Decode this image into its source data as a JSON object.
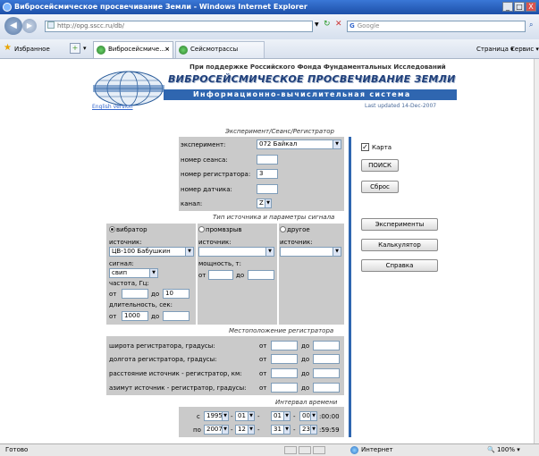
{
  "window": {
    "title": "Вибросейсмическое просвечивание Земли - Windows Internet Explorer",
    "min_label": "_",
    "max_label": "□",
    "close_label": "X"
  },
  "nav": {
    "address": "http://opg.sscc.ru/db/",
    "search_placeholder": "Google"
  },
  "tabs": {
    "favorites_label": "Избранное",
    "tab1": "Вибросейсмиче...",
    "tab2": "Сейсмотрассы",
    "page_menu": "Страница",
    "service_menu": "Сервис"
  },
  "header": {
    "support": "При поддержке Российского Фонда Фундаментальных Исследований",
    "title": "ВИБРОСЕЙСМИЧЕСКОЕ ПРОСВЕЧИВАНИЕ ЗЕМЛИ",
    "subtitle": "Информационно-вычислительная система",
    "english_link": "English version",
    "updated": "Last updated 14-Dec-2007"
  },
  "experiment": {
    "section_title": "Эксперимент/Сеанс/Регистратор",
    "experiment_label": "эксперимент:",
    "experiment_value": "072 Байкал",
    "session_label": "номер сеанса:",
    "session_value": "",
    "recorder_label": "номер регистратора:",
    "recorder_value": "3",
    "sensor_label": "номер датчика:",
    "sensor_value": "",
    "channel_label": "канал:",
    "channel_value": "Z"
  },
  "source": {
    "section_title": "Тип источника и параметры сигнала",
    "vibrator_label": "вибратор",
    "blast_label": "промвзрыв",
    "other_label": "другое",
    "source_label": "источник:",
    "vibrator_source_value": "ЦВ-100 Бабушкин",
    "blast_source_value": "",
    "other_source_value": "",
    "signal_label": "сигнал:",
    "signal_value": "свип",
    "power_label": "мощность, т:",
    "freq_label": "частота, Гц:",
    "from_label": "от",
    "to_label": "до",
    "freq_from": "",
    "freq_to": "10",
    "power_from": "",
    "power_to": "",
    "duration_label": "длительность, сек:",
    "duration_from": "1000",
    "duration_to": ""
  },
  "location": {
    "section_title": "Местоположение регистратора",
    "rows": [
      {
        "label": "широта регистратора, градусы:",
        "from_label": "от",
        "to_label": "до",
        "from": "",
        "to": ""
      },
      {
        "label": "долгота регистратора, градусы:",
        "from_label": "от",
        "to_label": "до",
        "from": "",
        "to": ""
      },
      {
        "label": "расстояние источник - регистратор, км:",
        "from_label": "от",
        "to_label": "до",
        "from": "",
        "to": ""
      },
      {
        "label": "азимут источник - регистратор, градусы:",
        "from_label": "от",
        "to_label": "до",
        "from": "",
        "to": ""
      }
    ]
  },
  "time": {
    "section_title": "Интервал времени",
    "from_label": "с",
    "to_label": "по",
    "from_year": "1995",
    "from_month": "01",
    "from_day": "01",
    "from_hour": "00",
    "from_rest": ":00:00",
    "to_year": "2007",
    "to_month": "12",
    "to_day": "31",
    "to_hour": "23",
    "to_rest": ":59:59"
  },
  "right": {
    "map_label": "Карта",
    "search_button": "ПОИСК",
    "reset_button": "Сброс",
    "experiments_button": "Эксперименты",
    "calculator_button": "Калькулятор",
    "help_button": "Справка"
  },
  "status": {
    "left": "Готово",
    "zone": "Интернет",
    "zoom": "100%"
  }
}
